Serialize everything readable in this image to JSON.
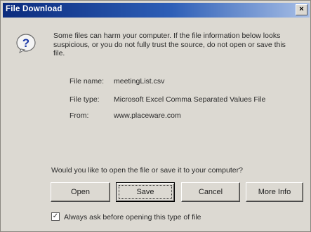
{
  "window": {
    "title": "File Download",
    "close_glyph": "×"
  },
  "icon": "question-icon",
  "message": "Some files can harm your computer. If the file information below looks suspicious, or you do not fully trust the source, do not open or save this file.",
  "file": {
    "name_label": "File name:",
    "name_value": "meetingList.csv",
    "type_label": "File type:",
    "type_value": "Microsoft Excel Comma Separated Values File",
    "from_label": "From:",
    "from_value": "www.placeware.com"
  },
  "question": "Would you like to open the file or save it to your computer?",
  "buttons": {
    "open": "Open",
    "save": "Save",
    "cancel": "Cancel",
    "more_info": "More Info"
  },
  "checkbox": {
    "checked": true,
    "mark": "✓",
    "label": "Always ask before opening this type of file"
  }
}
